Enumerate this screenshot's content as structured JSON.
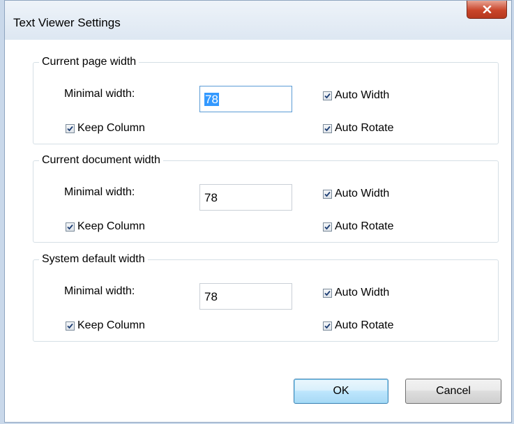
{
  "window": {
    "title": "Text Viewer Settings",
    "close_glyph": "x"
  },
  "groups": [
    {
      "legend": "Current page width",
      "min_width_label": "Minimal width:",
      "min_width_value": "78",
      "auto_width_label": "Auto Width",
      "auto_width_checked": true,
      "keep_column_label": "Keep Column",
      "keep_column_checked": true,
      "auto_rotate_label": "Auto Rotate",
      "auto_rotate_checked": true
    },
    {
      "legend": "Current document width",
      "min_width_label": "Minimal width:",
      "min_width_value": "78",
      "auto_width_label": "Auto Width",
      "auto_width_checked": true,
      "keep_column_label": "Keep Column",
      "keep_column_checked": true,
      "auto_rotate_label": "Auto Rotate",
      "auto_rotate_checked": true
    },
    {
      "legend": "System default width",
      "min_width_label": "Minimal width:",
      "min_width_value": "78",
      "auto_width_label": "Auto Width",
      "auto_width_checked": true,
      "keep_column_label": "Keep Column",
      "keep_column_checked": true,
      "auto_rotate_label": "Auto Rotate",
      "auto_rotate_checked": true
    }
  ],
  "buttons": {
    "ok": "OK",
    "cancel": "Cancel"
  },
  "colors": {
    "default_button_border": "#3c7fb1",
    "selection": "#3399ff",
    "close_button": "#c9452a"
  }
}
